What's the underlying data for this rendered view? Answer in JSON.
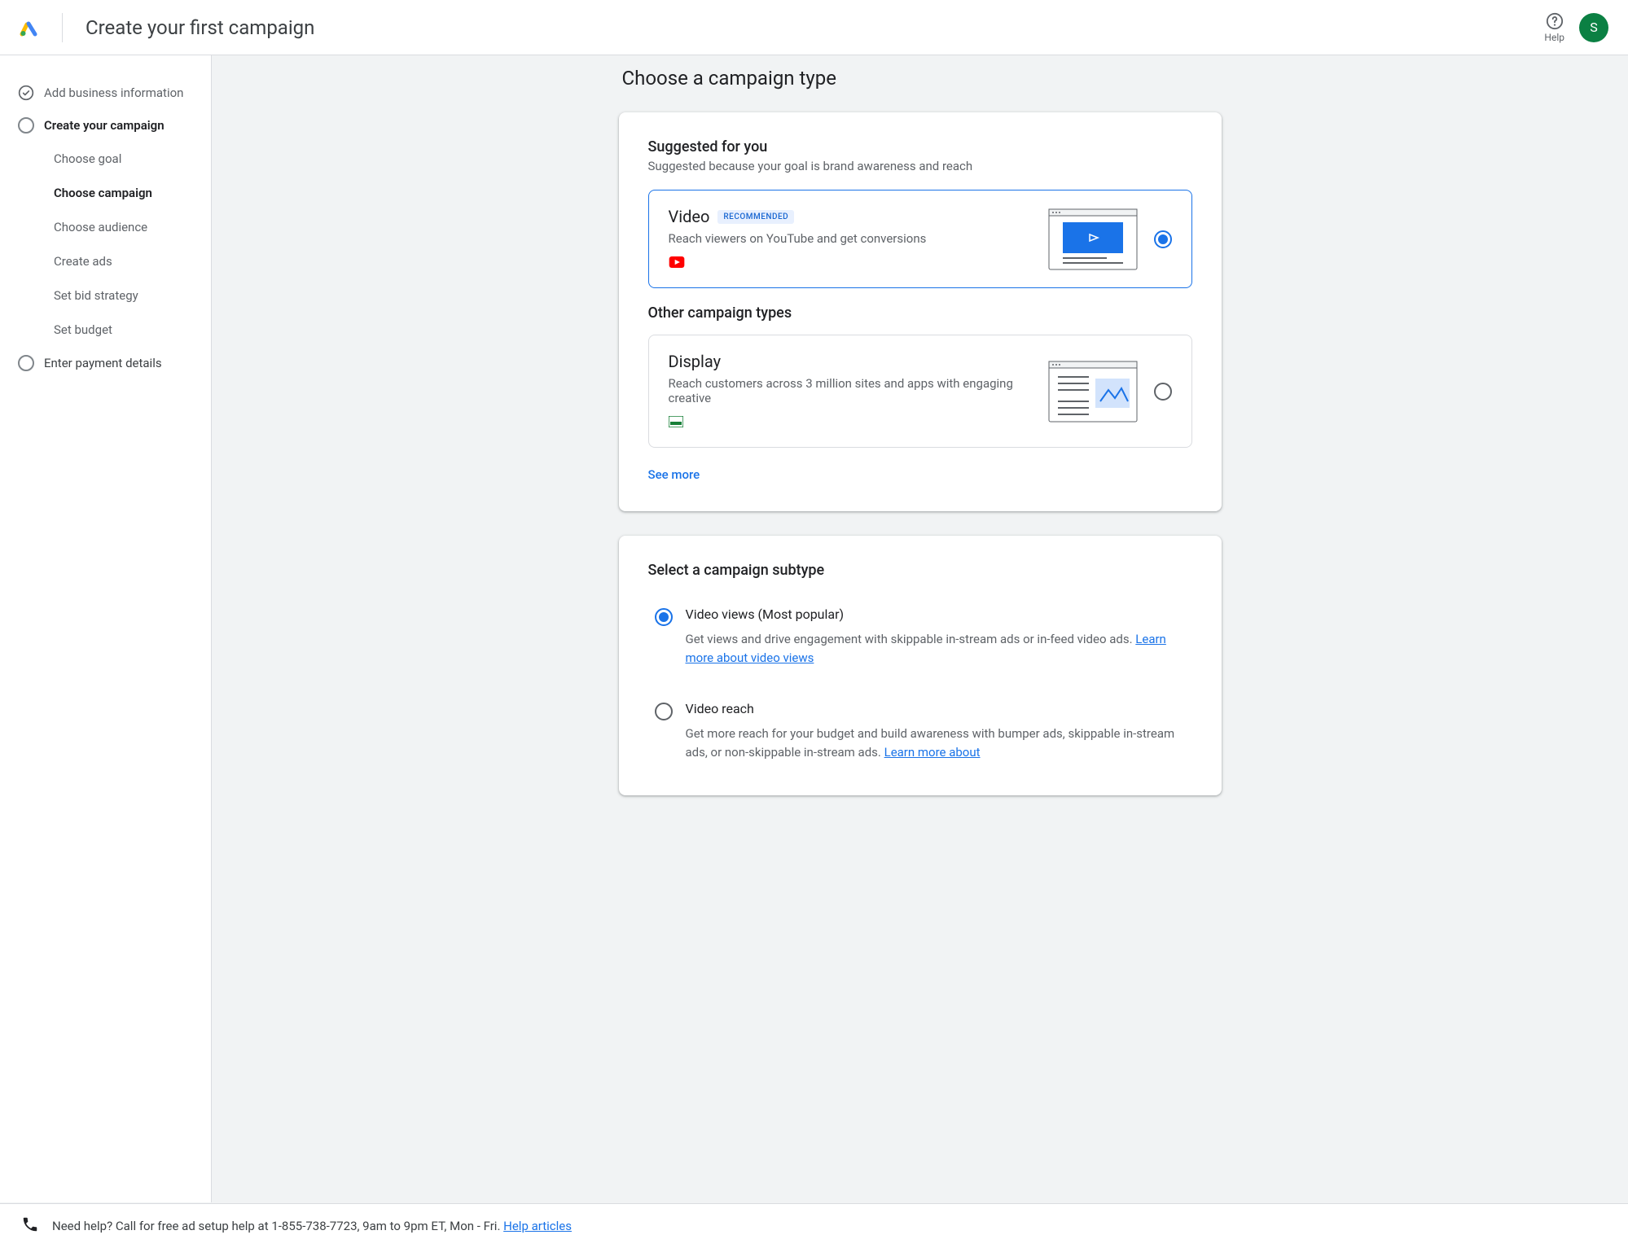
{
  "header": {
    "title": "Create your first campaign",
    "help_label": "Help",
    "avatar_initial": "S"
  },
  "sidebar": {
    "steps": [
      {
        "label": "Add business information",
        "state": "done"
      },
      {
        "label": "Create your campaign",
        "state": "current"
      },
      {
        "label": "Enter payment details",
        "state": "pending"
      }
    ],
    "substeps": [
      {
        "label": "Choose goal",
        "active": false
      },
      {
        "label": "Choose campaign",
        "active": true
      },
      {
        "label": "Choose audience",
        "active": false
      },
      {
        "label": "Create ads",
        "active": false
      },
      {
        "label": "Set bid strategy",
        "active": false
      },
      {
        "label": "Set budget",
        "active": false
      }
    ]
  },
  "main": {
    "heading": "Choose a campaign type",
    "suggested": {
      "title": "Suggested for you",
      "subtitle": "Suggested because your goal is brand awareness and reach"
    },
    "options": {
      "video": {
        "name": "Video",
        "badge": "RECOMMENDED",
        "desc": "Reach viewers on YouTube and get conversions"
      },
      "display": {
        "name": "Display",
        "desc": "Reach customers across 3 million sites and apps with engaging creative"
      }
    },
    "other_title": "Other campaign types",
    "see_more": "See more",
    "subtype": {
      "heading": "Select a campaign subtype",
      "views": {
        "title": "Video views (Most popular)",
        "desc": "Get views and drive engagement with skippable in-stream ads or in-feed video ads. ",
        "link": "Learn more about video views"
      },
      "reach": {
        "title": "Video reach",
        "desc": "Get more reach for your budget and build awareness with bumper ads, skippable in-stream ads, or non-skippable in-stream ads. ",
        "link": "Learn more about"
      }
    }
  },
  "footer": {
    "text": "Need help? Call for free ad setup help at 1-855-738-7723, 9am to 9pm ET, Mon - Fri. ",
    "link": "Help articles"
  }
}
